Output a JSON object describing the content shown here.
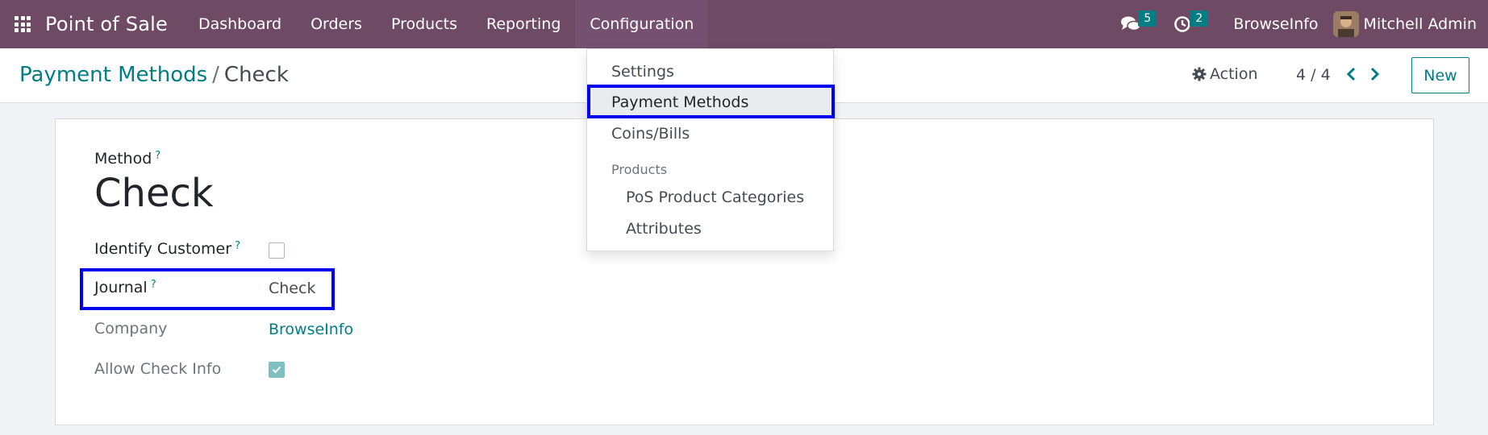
{
  "navbar": {
    "app_name": "Point of Sale",
    "menu": [
      "Dashboard",
      "Orders",
      "Products",
      "Reporting",
      "Configuration"
    ],
    "messages_count": "5",
    "activities_count": "2",
    "company": "BrowseInfo",
    "user": "Mitchell Admin"
  },
  "control_panel": {
    "breadcrumb_parent": "Payment Methods",
    "breadcrumb_separator": "/",
    "breadcrumb_current": "Check",
    "action_label": "Action",
    "pager": "4 / 4",
    "new_label": "New"
  },
  "form": {
    "name_label": "Method",
    "name_value": "Check",
    "help_mark": "?",
    "identify_customer_label": "Identify Customer",
    "identify_customer_checked": false,
    "journal_label": "Journal",
    "journal_value": "Check",
    "company_label": "Company",
    "company_value": "BrowseInfo",
    "allow_check_info_label": "Allow Check Info",
    "allow_check_info_checked": true
  },
  "dropdown": {
    "settings": "Settings",
    "payment_methods": "Payment Methods",
    "coins_bills": "Coins/Bills",
    "products_header": "Products",
    "pos_product_categories": "PoS Product Categories",
    "attributes": "Attributes"
  },
  "colors": {
    "navbar": "#6e4a64",
    "accent": "#017e84",
    "highlight": "#0000ee"
  }
}
